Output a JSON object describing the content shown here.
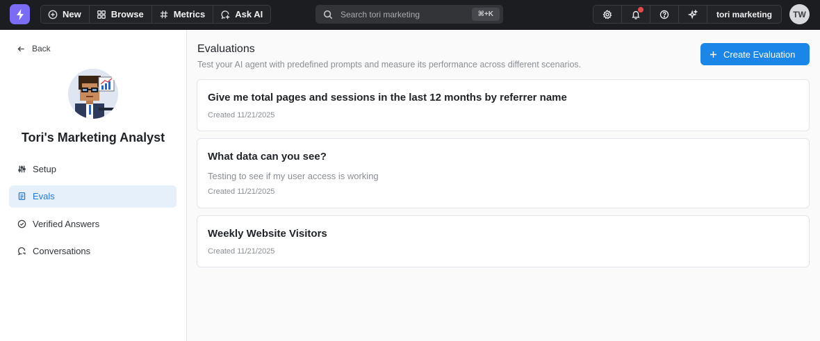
{
  "topbar": {
    "nav": [
      {
        "label": "New",
        "icon": "plus-circle-icon"
      },
      {
        "label": "Browse",
        "icon": "grid-icon"
      },
      {
        "label": "Metrics",
        "icon": "hash-icon"
      },
      {
        "label": "Ask AI",
        "icon": "chat-sparkle-icon"
      }
    ],
    "search_placeholder": "Search tori marketing",
    "search_shortcut": "⌘+K",
    "org_label": "tori marketing",
    "user_initials": "TW",
    "colors": {
      "bar": "#1c1d20",
      "logo": "#7b6cf6",
      "notification": "#e5484d"
    }
  },
  "sidebar": {
    "back_label": "Back",
    "agent_name": "Tori's Marketing Analyst",
    "menu": [
      {
        "label": "Setup",
        "icon": "sliders-icon",
        "active": false
      },
      {
        "label": "Evals",
        "icon": "clipboard-icon",
        "active": true
      },
      {
        "label": "Verified Answers",
        "icon": "check-circle-icon",
        "active": false
      },
      {
        "label": "Conversations",
        "icon": "chat-bubbles-icon",
        "active": false
      }
    ]
  },
  "main": {
    "title": "Evaluations",
    "subtitle": "Test your AI agent with predefined prompts and measure its performance across different scenarios.",
    "create_button": "Create Evaluation",
    "accent": "#1a86e8",
    "evaluations": [
      {
        "title": "Give me total pages and sessions in the last 12 months by referrer name",
        "description": "",
        "created": "Created 11/21/2025"
      },
      {
        "title": "What data can you see?",
        "description": "Testing to see if my user access is working",
        "created": "Created 11/21/2025"
      },
      {
        "title": "Weekly Website Visitors",
        "description": "",
        "created": "Created 11/21/2025"
      }
    ]
  }
}
